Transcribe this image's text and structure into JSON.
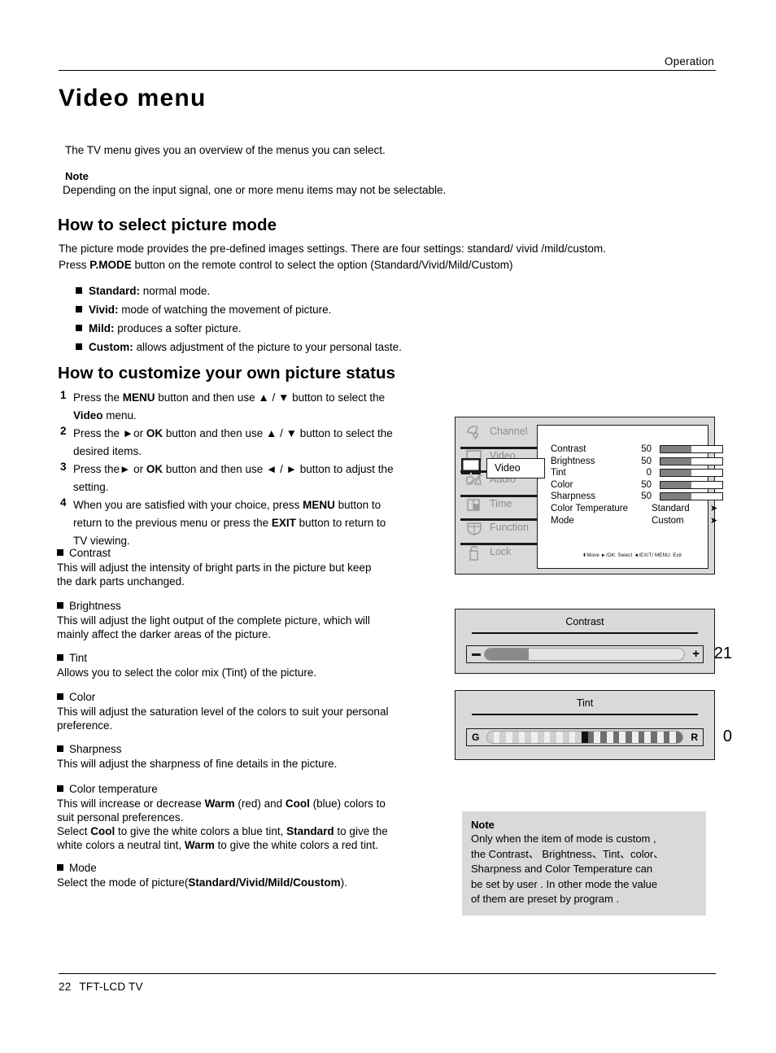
{
  "header": {
    "section": "Operation"
  },
  "footer": {
    "page_number": "22",
    "product": "TFT-LCD TV"
  },
  "page_title": "Video menu",
  "intro": {
    "paragraph": "The TV menu gives you an overview of the menus you can select.",
    "note_label": "Note",
    "note_text": "Depending on the input signal, one or more menu items may not be selectable."
  },
  "picture_mode": {
    "heading": "How to select picture mode",
    "para_line1": "The picture mode provides the pre-defined images settings. There are four settings: standard/ vivid /mild/custom.",
    "para_line2_a": "Press  ",
    "para_line2_b": "P.MODE",
    "para_line2_c": " button on the remote control to select the option (Standard/Vivid/Mild/Custom)",
    "items": [
      {
        "term": "Standard:",
        "desc": " normal mode."
      },
      {
        "term": "Vivid:",
        "desc": " mode of watching the movement of picture."
      },
      {
        "term": "Mild:",
        "desc": " produces a softer picture."
      },
      {
        "term": "Custom:",
        "desc": " allows adjustment of the picture to your personal taste."
      }
    ]
  },
  "customize": {
    "heading": "How to customize your own picture status",
    "steps": [
      {
        "num": "1",
        "lines": [
          {
            "parts": [
              {
                "t": "Press the ",
                "b": false
              },
              {
                "t": "MENU",
                "b": true
              },
              {
                "t": " button and then use ▲ / ▼ button to select the",
                "b": false
              }
            ]
          },
          {
            "parts": [
              {
                "t": "Video",
                "b": true
              },
              {
                "t": " menu.",
                "b": false
              }
            ]
          }
        ]
      },
      {
        "num": "2",
        "lines": [
          {
            "parts": [
              {
                "t": "Press the ►or ",
                "b": false
              },
              {
                "t": "OK",
                "b": true
              },
              {
                "t": "  button and then use ▲ / ▼ button to select the",
                "b": false
              }
            ]
          },
          {
            "parts": [
              {
                "t": "desired items.",
                "b": false
              }
            ]
          }
        ]
      },
      {
        "num": "3",
        "lines": [
          {
            "parts": [
              {
                "t": "Press the► or ",
                "b": false
              },
              {
                "t": "OK",
                "b": true
              },
              {
                "t": " button and then use ◄ / ► button to adjust the",
                "b": false
              }
            ]
          },
          {
            "parts": [
              {
                "t": "setting.",
                "b": false
              }
            ]
          }
        ]
      },
      {
        "num": "4",
        "lines": [
          {
            "parts": [
              {
                "t": "When you are satisfied with your choice,  press  ",
                "b": false
              },
              {
                "t": "MENU",
                "b": true
              },
              {
                "t": " button to",
                "b": false
              }
            ]
          },
          {
            "parts": [
              {
                "t": "return to the previous menu or press the ",
                "b": false
              },
              {
                "t": "EXIT",
                "b": true
              },
              {
                "t": " button to return to",
                "b": false
              }
            ]
          },
          {
            "parts": [
              {
                "t": "TV viewing.",
                "b": false
              }
            ]
          }
        ]
      }
    ]
  },
  "descriptions": [
    {
      "id": "contrast",
      "title": "Contrast",
      "lines": [
        "This will adjust the intensity of bright parts in the picture but keep",
        "the dark parts unchanged."
      ]
    },
    {
      "id": "brightness",
      "title": "Brightness",
      "lines": [
        "This will adjust the light output of the complete picture, which will",
        "mainly affect the darker areas of the picture."
      ]
    },
    {
      "id": "tint",
      "title": "Tint",
      "lines": [
        "Allows you to select the color mix (Tint) of the picture."
      ]
    },
    {
      "id": "color",
      "title": "Color",
      "lines": [
        "This will adjust the saturation level of the colors to suit your personal",
        "preference."
      ]
    },
    {
      "id": "sharpness",
      "title": "Sharpness",
      "lines": [
        "This will adjust the sharpness of fine details in the picture."
      ]
    }
  ],
  "colortemp": {
    "title": "Color temperature",
    "line1_parts": [
      {
        "t": "This will increase or decrease ",
        "b": false
      },
      {
        "t": "Warm",
        "b": true
      },
      {
        "t": " (red) and ",
        "b": false
      },
      {
        "t": "Cool",
        "b": true
      },
      {
        "t": " (blue) colors to",
        "b": false
      }
    ],
    "line2_parts": [
      {
        "t": "suit personal preferences.",
        "b": false
      }
    ],
    "line3_parts": [
      {
        "t": "Select ",
        "b": false
      },
      {
        "t": "Cool",
        "b": true
      },
      {
        "t": " to give the white colors a blue tint, ",
        "b": false
      },
      {
        "t": "Standard",
        "b": true
      },
      {
        "t": " to give the",
        "b": false
      }
    ],
    "line4_parts": [
      {
        "t": " white colors a neutral tint, ",
        "b": false
      },
      {
        "t": "Warm",
        "b": true
      },
      {
        "t": " to give the white colors a red tint.",
        "b": false
      }
    ]
  },
  "mode_desc": {
    "title": "Mode",
    "line_parts": [
      {
        "t": "Select the mode of picture(",
        "b": false
      },
      {
        "t": "Standard/Vivid/Mild/Coustom",
        "b": true
      },
      {
        "t": ").",
        "b": false
      }
    ]
  },
  "osd": {
    "sidebar": [
      {
        "label": "Channel",
        "icon": "satellite-dish-icon",
        "selected": false
      },
      {
        "label": "Video",
        "icon": "tv-screen-icon",
        "selected": true
      },
      {
        "label": "Audio",
        "icon": "speaker-note-icon",
        "selected": false
      },
      {
        "label": "Time",
        "icon": "clock-calendar-icon",
        "selected": false
      },
      {
        "label": "Function",
        "icon": "shield-icon",
        "selected": false
      },
      {
        "label": "Lock",
        "icon": "padlock-icon",
        "selected": false
      }
    ],
    "items": [
      {
        "name": "Contrast",
        "value": "50",
        "type": "bar",
        "fill_percent": 50
      },
      {
        "name": "Brightness",
        "value": "50",
        "type": "bar",
        "fill_percent": 50
      },
      {
        "name": "Tint",
        "value": "0",
        "type": "bar",
        "fill_percent": 50
      },
      {
        "name": "Color",
        "value": "50",
        "type": "bar",
        "fill_percent": 50
      },
      {
        "name": "Sharpness",
        "value": "50",
        "type": "bar",
        "fill_percent": 50
      },
      {
        "name": "Color Temperature",
        "value": "Standard",
        "type": "text",
        "arrow": "➤"
      },
      {
        "name": "Mode",
        "value": "Custom",
        "type": "text",
        "arrow": "➤"
      }
    ],
    "hint": "Move  ►/OK: Select  ◄/EXIT/ MENU: Exit",
    "hint_move_glyph": "⬍"
  },
  "figures": {
    "contrast": {
      "title": "Contrast",
      "value": "21",
      "fill_percent": 22,
      "minus_label": "−",
      "plus_label": "+"
    },
    "tint": {
      "title": "Tint",
      "value": "0",
      "left_label": "G",
      "right_label": "R",
      "marker_index": 15,
      "segments": 31
    }
  },
  "side_note": {
    "label": "Note",
    "lines": [
      "Only when the item of mode is custom ,",
      "the Contrast、  Brightness、Tint、color、",
      "Sharpness and Color Temperature can",
      "be set by user . In other mode the value",
      "of them are preset by program ."
    ]
  },
  "colors": {
    "panel_gray": "#d9d9d9",
    "bar_fill": "#808080",
    "osd_label_gray": "#8c8c8c",
    "ink": "#000000"
  }
}
